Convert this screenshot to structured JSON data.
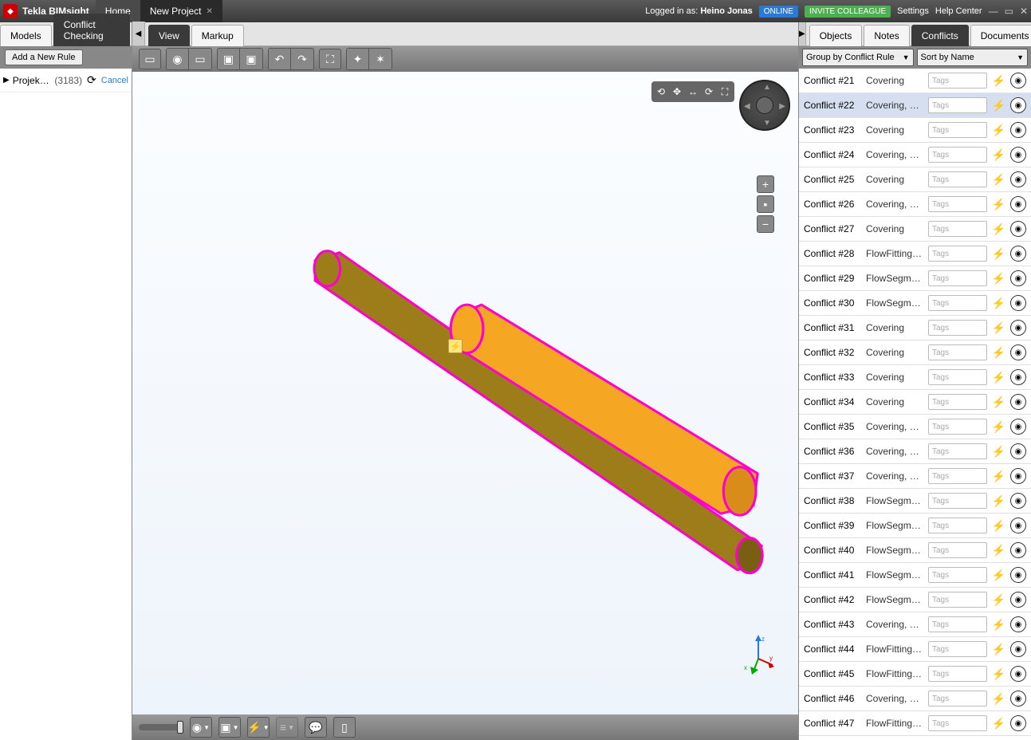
{
  "titlebar": {
    "appname": "Tekla BIMsight",
    "home": "Home",
    "project_tab": "New Project",
    "logged_in_prefix": "Logged in as: ",
    "username": "Heino Jonas",
    "online": "ONLINE",
    "invite": "INVITE COLLEAGUE",
    "settings": "Settings",
    "help": "Help Center"
  },
  "left": {
    "tabs": {
      "models": "Models",
      "conflict": "Conflict Checking"
    },
    "add_rule": "Add a New Rule",
    "project_name": "Projekt XXXX",
    "project_count": "(3183)",
    "cancel": "Cancel"
  },
  "mid": {
    "tabs": {
      "view": "View",
      "markup": "Markup"
    }
  },
  "right": {
    "tabs": {
      "objects": "Objects",
      "notes": "Notes",
      "conflicts": "Conflicts",
      "documents": "Documents"
    },
    "group_by": "Group by Conflict Rule",
    "sort_by": "Sort by Name",
    "tags_placeholder": "Tags",
    "conflicts": [
      {
        "id": "Conflict #21",
        "type": "Covering"
      },
      {
        "id": "Conflict #22",
        "type": "Covering, FlowSeg...",
        "selected": true
      },
      {
        "id": "Conflict #23",
        "type": "Covering"
      },
      {
        "id": "Conflict #24",
        "type": "Covering, FlowFi..."
      },
      {
        "id": "Conflict #25",
        "type": "Covering"
      },
      {
        "id": "Conflict #26",
        "type": "Covering, FlowSeg..."
      },
      {
        "id": "Conflict #27",
        "type": "Covering"
      },
      {
        "id": "Conflict #28",
        "type": "FlowFitting, FlowS..."
      },
      {
        "id": "Conflict #29",
        "type": "FlowSegment"
      },
      {
        "id": "Conflict #30",
        "type": "FlowSegment"
      },
      {
        "id": "Conflict #31",
        "type": "Covering"
      },
      {
        "id": "Conflict #32",
        "type": "Covering"
      },
      {
        "id": "Conflict #33",
        "type": "Covering"
      },
      {
        "id": "Conflict #34",
        "type": "Covering"
      },
      {
        "id": "Conflict #35",
        "type": "Covering, FlowSeg..."
      },
      {
        "id": "Conflict #36",
        "type": "Covering, FlowSeg..."
      },
      {
        "id": "Conflict #37",
        "type": "Covering, FlowSeg..."
      },
      {
        "id": "Conflict #38",
        "type": "FlowSegment"
      },
      {
        "id": "Conflict #39",
        "type": "FlowSegment"
      },
      {
        "id": "Conflict #40",
        "type": "FlowSegment"
      },
      {
        "id": "Conflict #41",
        "type": "FlowSegment"
      },
      {
        "id": "Conflict #42",
        "type": "FlowSegment"
      },
      {
        "id": "Conflict #43",
        "type": "Covering, FlowSeg..."
      },
      {
        "id": "Conflict #44",
        "type": "FlowFitting, FlowS..."
      },
      {
        "id": "Conflict #45",
        "type": "FlowFitting, FlowS..."
      },
      {
        "id": "Conflict #46",
        "type": "Covering, FlowSeg..."
      },
      {
        "id": "Conflict #47",
        "type": "FlowFitting, FlowS..."
      }
    ]
  }
}
